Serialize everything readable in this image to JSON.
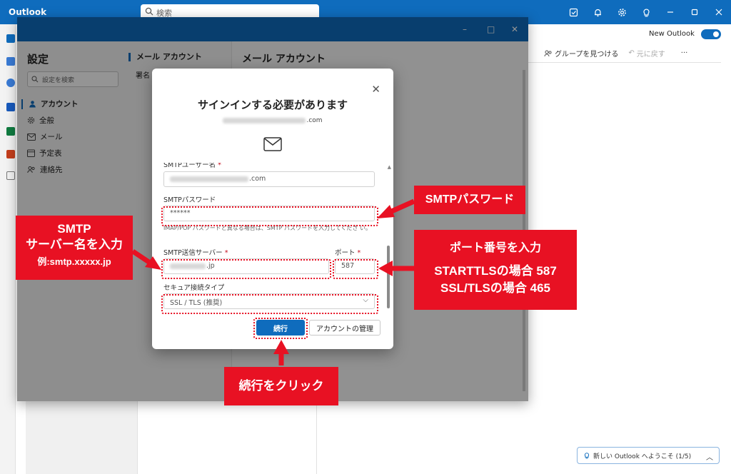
{
  "app": {
    "title": "Outlook",
    "search_placeholder": "検索"
  },
  "topbar_icons": [
    "tasks-icon",
    "bell-icon",
    "gear-icon",
    "lightbulb-icon",
    "minimize-icon",
    "maximize-icon",
    "close-icon"
  ],
  "background": {
    "new_outlook_label": "New Outlook",
    "new_outlook_on": true,
    "ribbon": {
      "find_groups": "グループを見つける",
      "undo": "元に戻す",
      "more": "···"
    },
    "welcome_banner": "新しい Outlook へようこそ (1/5)"
  },
  "settings": {
    "title": "設定",
    "search_placeholder": "設定を検索",
    "nav": [
      {
        "label": "アカウント",
        "icon": "person-icon",
        "active": true
      },
      {
        "label": "全般",
        "icon": "gear-icon",
        "active": false
      },
      {
        "label": "メール",
        "icon": "mail-icon",
        "active": false
      },
      {
        "label": "予定表",
        "icon": "calendar-icon",
        "active": false
      },
      {
        "label": "連絡先",
        "icon": "people-icon",
        "active": false
      }
    ],
    "sub_header": "メール アカウント",
    "sub_item": "署名",
    "pane_title": "メール アカウント"
  },
  "dialog": {
    "title": "サインインする必要があります",
    "email_suffix": ".com",
    "fields": {
      "smtp_user_label": "SMTPユーザー名",
      "smtp_user_value_suffix": ".com",
      "smtp_password_label": "SMTPパスワード",
      "smtp_password_value": "******",
      "password_hint": "IMAP/POP パスワードと異なる場合は、SMTP パスワードを入力してくださ い。",
      "smtp_server_label": "SMTP送信サーバー",
      "smtp_server_value_suffix": ".jp",
      "port_label": "ポート",
      "port_value": "587",
      "security_label": "セキュア接続タイプ",
      "security_value": "SSL / TLS (推奨)"
    },
    "continue_button": "続行",
    "manage_button": "アカウントの管理"
  },
  "annotations": {
    "password_callout": "SMTPパスワード",
    "server_callout_line1": "SMTP",
    "server_callout_line2": "サーバー名を入力",
    "server_callout_line3": "例:smtp.xxxxx.jp",
    "port_callout_line1": "ポート番号を入力",
    "port_callout_line2": "STARTTLSの場合 587",
    "port_callout_line3": "SSL/TLSの場合 465",
    "continue_callout": "続行をクリック",
    "color": "#e81123"
  },
  "colors": {
    "accent": "#0f6cbd",
    "annotation": "#e81123"
  }
}
